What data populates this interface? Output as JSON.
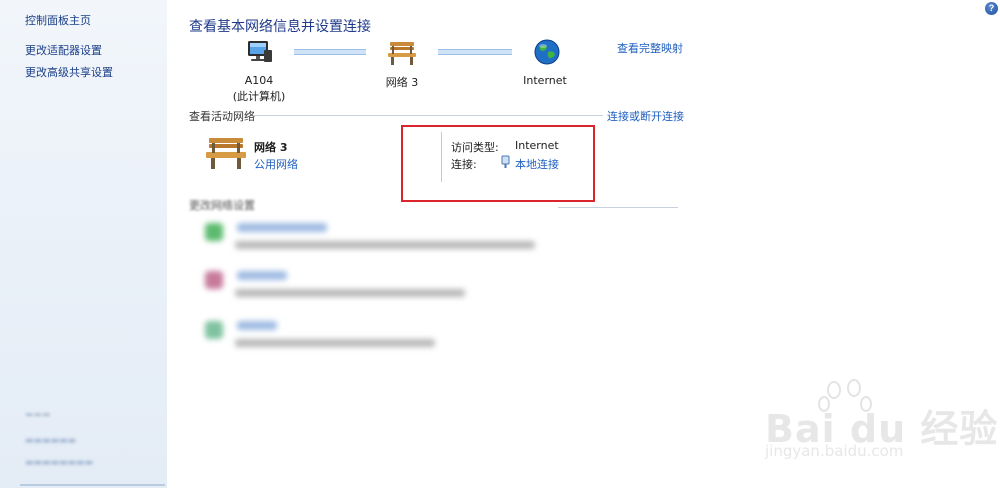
{
  "sidebar": {
    "home": "控制面板主页",
    "adapter_settings": "更改适配器设置",
    "sharing_settings": "更改高级共享设置"
  },
  "help": {
    "label": "?"
  },
  "title": "查看基本网络信息并设置连接",
  "map": {
    "full_map_link": "查看完整映射",
    "computer": {
      "name": "A104",
      "sub": "(此计算机)",
      "icon": "computer-icon"
    },
    "network": {
      "name": "网络  3",
      "icon": "bench-icon"
    },
    "internet": {
      "name": "Internet",
      "icon": "globe-icon"
    }
  },
  "active": {
    "heading": "查看活动网络",
    "connect_link": "连接或断开连接",
    "network_name": "网络  3",
    "network_type": "公用网络",
    "access_type_label": "访问类型:",
    "access_type_value": "Internet",
    "connection_label": "连接:",
    "connection_value": "本地连接"
  },
  "change": {
    "heading": "更改网络设置"
  },
  "watermark": {
    "brand": "Bai du 经验",
    "url": "jingyan.baidu.com"
  },
  "colors": {
    "link": "#1f5fbf",
    "title": "#1e3a8a",
    "highlight_box": "#d9252b",
    "sidebar_bg": "#e9f0f8"
  }
}
